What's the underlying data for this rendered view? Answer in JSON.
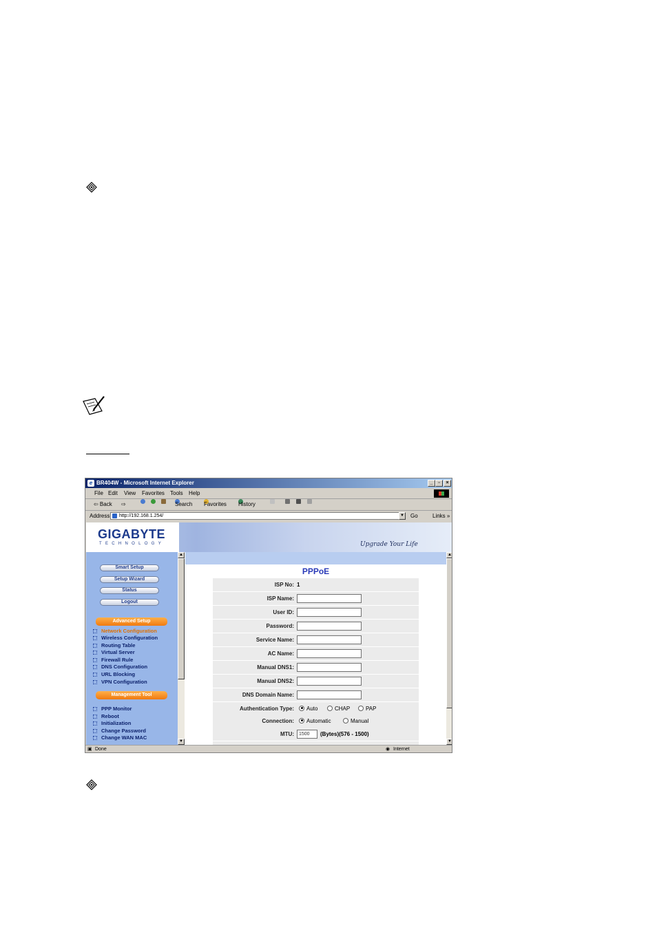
{
  "window": {
    "title": "BR404W - Microsoft Internet Explorer",
    "controls": {
      "minimize": "_",
      "maximize": "▫",
      "close": "×"
    }
  },
  "menu": [
    "File",
    "Edit",
    "View",
    "Favorites",
    "Tools",
    "Help"
  ],
  "toolbar": {
    "back": "⇦ Back",
    "forward": "⇨",
    "search": "Search",
    "favorites": "Favorites",
    "history": "History"
  },
  "address": {
    "label": "Address",
    "url": "http://192.168.1.254/",
    "go": "Go",
    "links": "Links »"
  },
  "brand": {
    "logo": "GIGABYTE",
    "logo_sub": "TECHNOLOGY",
    "slogan": "Upgrade Your Life"
  },
  "sidebar": {
    "buttons": [
      "Smart Setup",
      "Setup Wizard",
      "Status",
      "Logout"
    ],
    "advanced_header": "Advanced Setup",
    "advanced_items": [
      "Network Configuration",
      "Wireless Configuration",
      "Routing Table",
      "Virtual Server",
      "Firewall Rule",
      "DNS Configuration",
      "URL Blocking",
      "VPN Configuration"
    ],
    "management_header": "Management Tool",
    "management_items": [
      "PPP Monitor",
      "Reboot",
      "Initialization",
      "Change Password",
      "Change WAN MAC"
    ]
  },
  "form": {
    "title": "PPPoE",
    "isp_no_label": "ISP No:",
    "isp_no_value": "1",
    "isp_name_label": "ISP Name:",
    "user_id_label": "User ID:",
    "password_label": "Password:",
    "service_name_label": "Service Name:",
    "ac_name_label": "AC Name:",
    "dns1_label": "Manual DNS1:",
    "dns2_label": "Manual DNS2:",
    "domain_label": "DNS Domain Name:",
    "auth_label": "Authentication Type:",
    "auth_options": [
      "Auto",
      "CHAP",
      "PAP"
    ],
    "auth_selected": "Auto",
    "connection_label": "Connection:",
    "connection_options": [
      "Automatic",
      "Manual"
    ],
    "connection_selected": "Automatic",
    "mtu_label": "MTU:",
    "mtu_value": "1500",
    "mtu_hint": "(Bytes)(576 - 1500)"
  },
  "status": {
    "done": "Done",
    "zone": "Internet"
  }
}
